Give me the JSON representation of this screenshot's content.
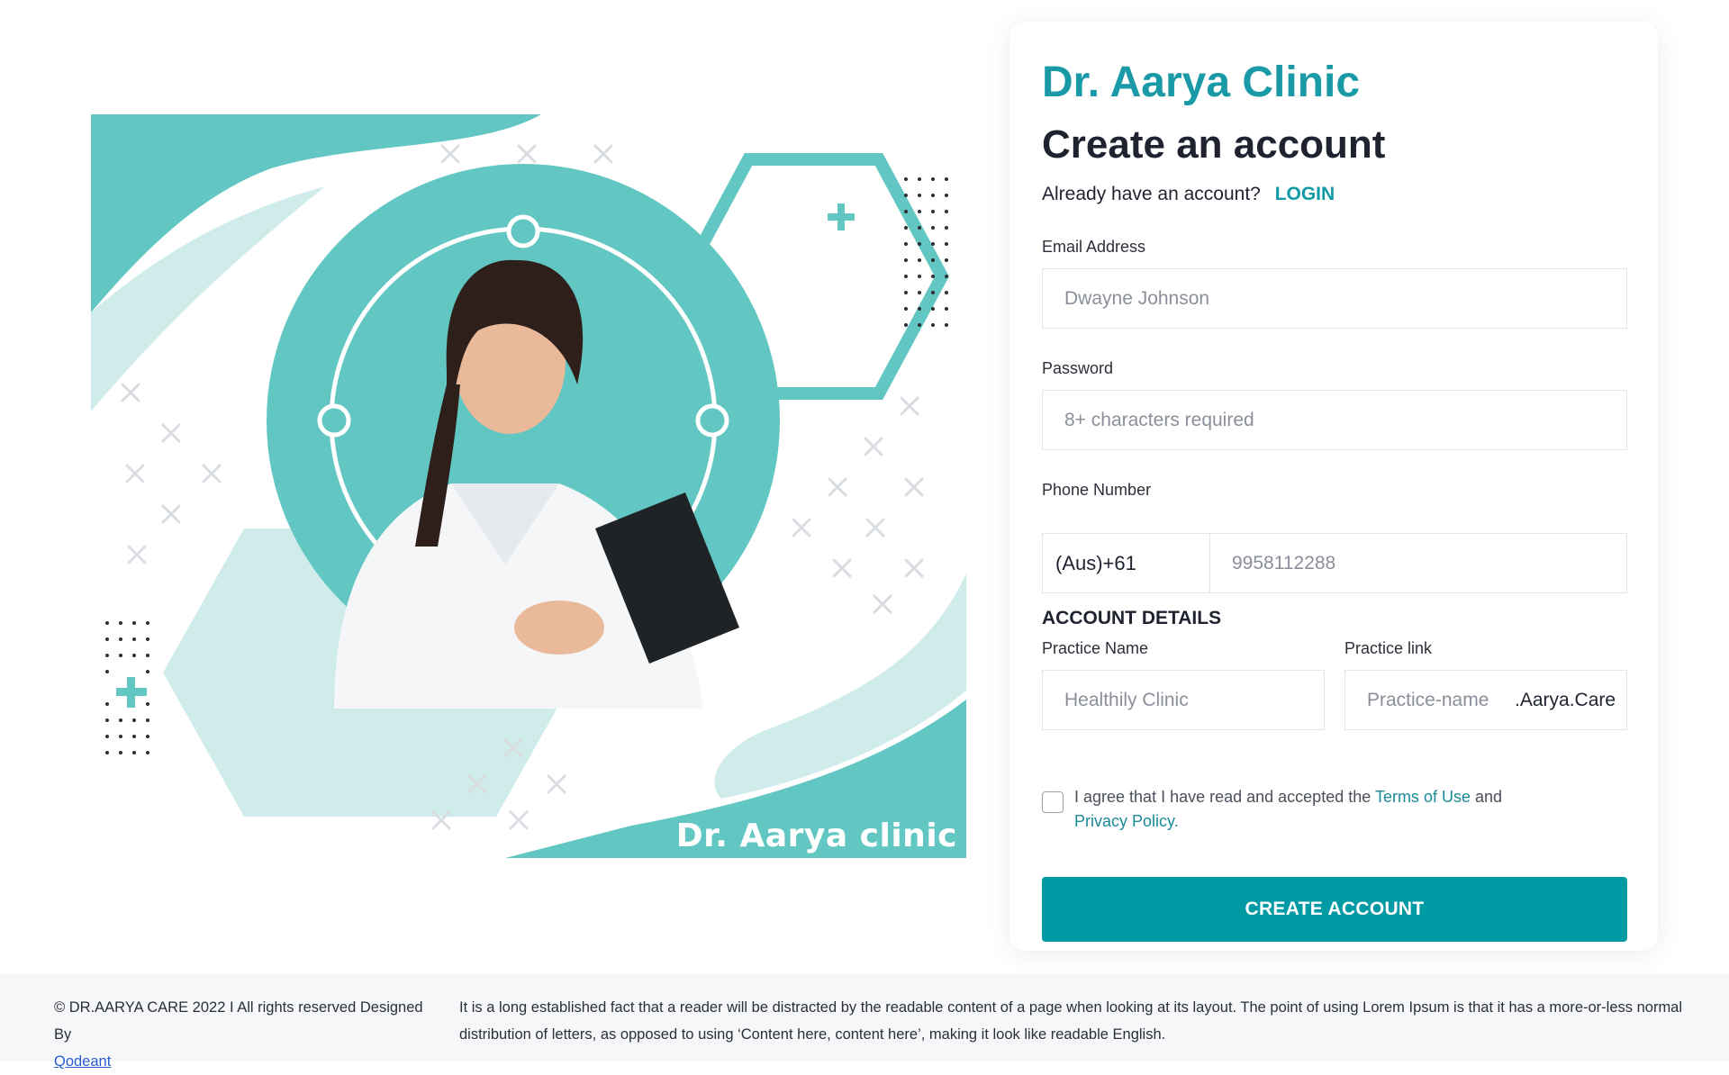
{
  "colors": {
    "brand": "#1a9aa6",
    "button": "#009aa5",
    "teal_light": "#cfeceb",
    "teal_mid": "#62c7c2",
    "link": "#1a8a98"
  },
  "illustration": {
    "caption": "Dr. Aarya clinic"
  },
  "card": {
    "brand": "Dr. Aarya Clinic",
    "heading": "Create an account",
    "login_prompt": "Already have an account?",
    "login_link": "LOGIN",
    "email": {
      "label": "Email Address",
      "placeholder": "Dwayne Johnson"
    },
    "password": {
      "label": "Password",
      "placeholder": "8+ characters required"
    },
    "phone": {
      "label": "Phone Number",
      "prefix": "(Aus)+61",
      "placeholder": "9958112288"
    },
    "account_details_title": "ACCOUNT DETAILS",
    "practice_name": {
      "label": "Practice Name",
      "placeholder": "Healthily Clinic"
    },
    "practice_link": {
      "label": "Practice link",
      "placeholder": "Practice-name",
      "suffix": ".Aarya.Care"
    },
    "terms": {
      "prefix": "I agree that I have read and accepted the",
      "terms_link": "Terms of Use",
      "and": "and",
      "privacy_link": "Privacy Policy."
    },
    "submit_label": "CREATE ACCOUNT"
  },
  "footer": {
    "copyright": "© DR.AARYA CARE 2022 I All rights reserved Designed By",
    "designer_link": "Qodeant",
    "description": "It is a long established fact that a reader will be distracted by the readable content of a page when looking at its layout. The point of using Lorem Ipsum is that it has a more-or-less normal distribution of letters, as opposed to using ‘Content here, content here’, making it look like readable English."
  }
}
